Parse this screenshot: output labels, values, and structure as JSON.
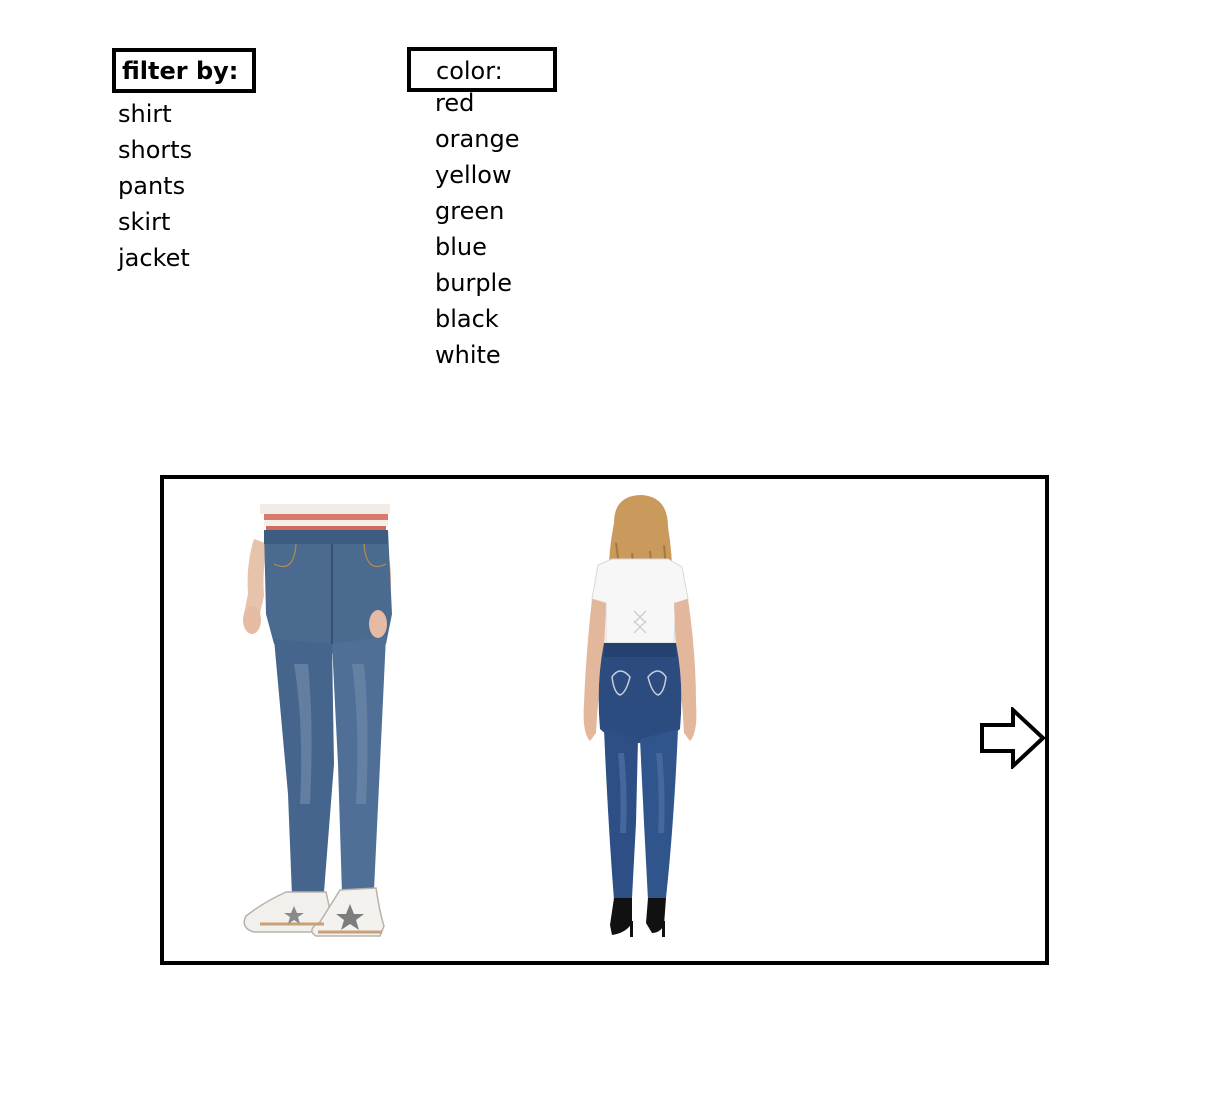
{
  "filter": {
    "heading": "filter by:",
    "types": [
      "shirt",
      "shorts",
      "pants",
      "skirt",
      "jacket"
    ]
  },
  "color": {
    "heading": "color:",
    "options": [
      "red",
      "orange",
      "yellow",
      "green",
      "blue",
      "burple",
      "black",
      "white"
    ]
  },
  "gallery": {
    "products": [
      {
        "name": "men-jeans",
        "icon": "product-photo-men-jeans"
      },
      {
        "name": "women-jeans",
        "icon": "product-photo-women-jeans"
      }
    ],
    "next_icon": "arrow-right-icon"
  },
  "colors": {
    "border": "#000000",
    "denim_dark": "#2a4d80",
    "denim_mid": "#4a6a90"
  }
}
